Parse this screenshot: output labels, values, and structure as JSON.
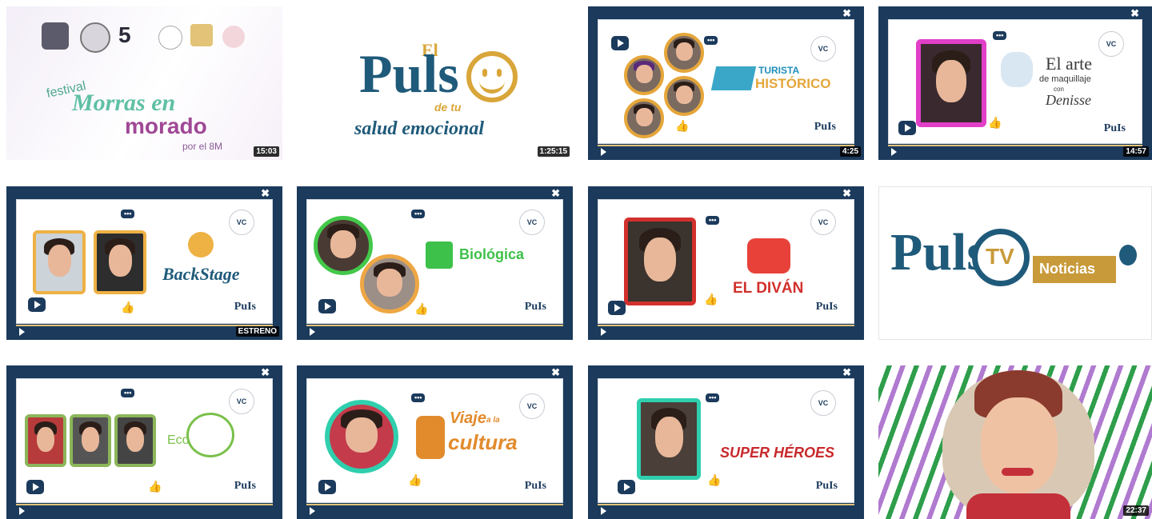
{
  "videos": [
    {
      "title_line1": "festival",
      "title_line2": "Morras en",
      "title_line3": "morado",
      "title_line4": "por el 8M",
      "duration": "15:03"
    },
    {
      "title_top": "El",
      "title_main": "Puls",
      "title_small": "de tu",
      "title_bottom": "salud emocional",
      "duration": "1:25:15"
    },
    {
      "title_line1": "TURISTA",
      "title_line2": "HISTÓRICO",
      "duration": "4:25"
    },
    {
      "title_line1": "El arte",
      "title_line2": "de maquillaje",
      "title_line3": "con",
      "title_line4": "Denisse",
      "duration": "14:57"
    },
    {
      "title_line1": "BackStage",
      "duration": "ESTRENO"
    },
    {
      "title_line1": "Biológica",
      "duration": ""
    },
    {
      "title_line1": "EL DIVÁN",
      "duration": ""
    },
    {
      "title_main": "Puls",
      "title_tv": "TV",
      "title_side": "Noticias",
      "duration": ""
    },
    {
      "title_line1": "Eco",
      "duration": ""
    },
    {
      "title_line1": "Viaje",
      "title_line2": "a la",
      "title_line3": "cultura",
      "duration": ""
    },
    {
      "title_line1": "SUPER HÉROES",
      "duration": ""
    },
    {
      "duration": "22:37"
    }
  ],
  "player_ui": {
    "close_glyph": "✖",
    "bubble": "•••",
    "logo_text": "PuIs"
  }
}
